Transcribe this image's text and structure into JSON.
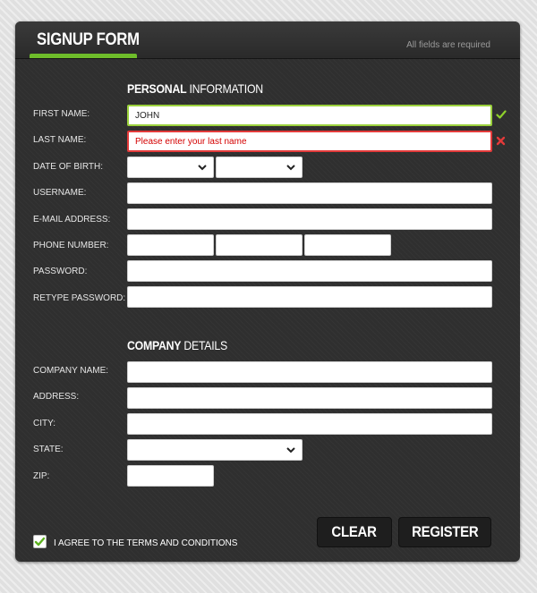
{
  "form": {
    "title": "SIGNUP FORM",
    "required_note": "All fields are required"
  },
  "personal": {
    "title_bold": "PERSONAL",
    "title_light": "INFORMATION",
    "first_name": {
      "label": "FIRST NAME:",
      "value": "JOHN",
      "status": "valid"
    },
    "last_name": {
      "label": "LAST NAME:",
      "value": "Please enter your last name",
      "status": "error"
    },
    "dob": {
      "label": "DATE OF BIRTH:"
    },
    "username": {
      "label": "USERNAME:"
    },
    "email": {
      "label": "E-MAIL ADDRESS:"
    },
    "phone": {
      "label": "PHONE NUMBER:"
    },
    "password": {
      "label": "PASSWORD:"
    },
    "retype_password": {
      "label": "RETYPE PASSWORD:"
    }
  },
  "company": {
    "title_bold": "COMPANY",
    "title_light": "DETAILS",
    "company_name": {
      "label": "COMPANY NAME:"
    },
    "address": {
      "label": "ADDRESS:"
    },
    "city": {
      "label": "CITY:"
    },
    "state": {
      "label": "STATE:"
    },
    "zip": {
      "label": "ZIP:"
    }
  },
  "actions": {
    "clear_label": "CLEAR",
    "register_label": "REGISTER"
  },
  "terms": {
    "label": "I AGREE TO THE TERMS AND CONDITIONS",
    "checked": true
  },
  "colors": {
    "accent_green": "#6ebd2a",
    "error_red": "#e33a3a",
    "panel_bg": "#2f2f2f"
  }
}
